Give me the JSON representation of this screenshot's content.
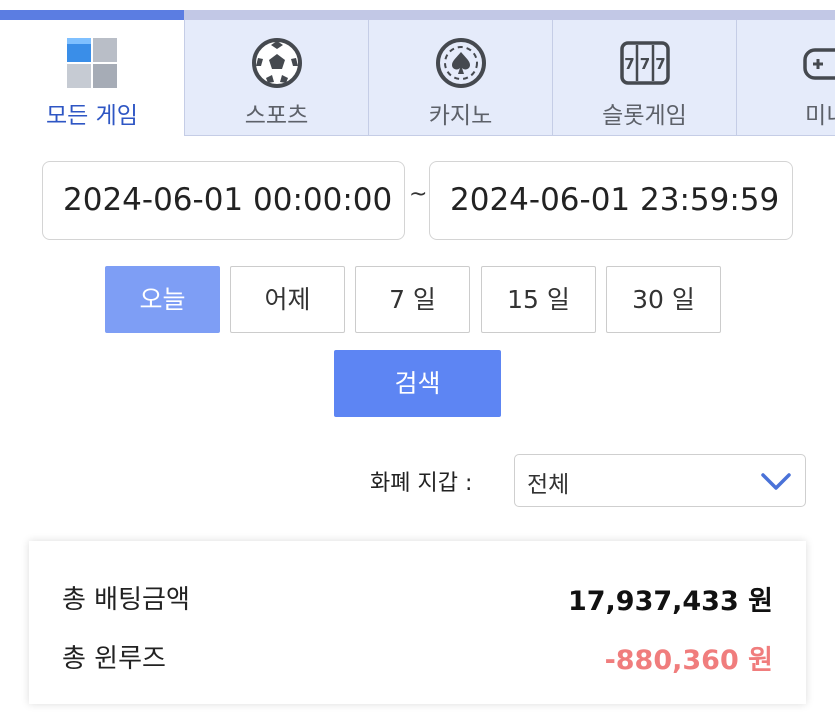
{
  "tabs": [
    {
      "label": "모든 게임",
      "icon": "all-games-cubes-icon",
      "active": true
    },
    {
      "label": "스포츠",
      "icon": "soccer-ball-icon",
      "active": false
    },
    {
      "label": "카지노",
      "icon": "casino-chip-spade-icon",
      "active": false
    },
    {
      "label": "슬롯게임",
      "icon": "slot-777-icon",
      "active": false
    },
    {
      "label": "미니",
      "icon": "gamepad-icon",
      "active": false
    }
  ],
  "date_range": {
    "start": "2024-06-01 00:00:00",
    "separator": "~",
    "end": "2024-06-01 23:59:59"
  },
  "quick_ranges": [
    {
      "label": "오늘",
      "active": true
    },
    {
      "label": "어제",
      "active": false
    },
    {
      "label": "7 일",
      "active": false
    },
    {
      "label": "15 일",
      "active": false
    },
    {
      "label": "30 일",
      "active": false
    }
  ],
  "search": {
    "label": "검색"
  },
  "wallet": {
    "label": "화폐 지갑 :",
    "selected": "전체"
  },
  "summary": {
    "total_bet_label": "총 배팅금액",
    "total_bet_value": "17,937,433 원",
    "total_winloss_label": "총 윈루즈",
    "total_winloss_value": "-880,360 원"
  },
  "colors": {
    "accent": "#5d85f3",
    "active_chip": "#7e9ef5",
    "tab_active_text": "#2e56c4",
    "negative": "#f07d7d"
  }
}
